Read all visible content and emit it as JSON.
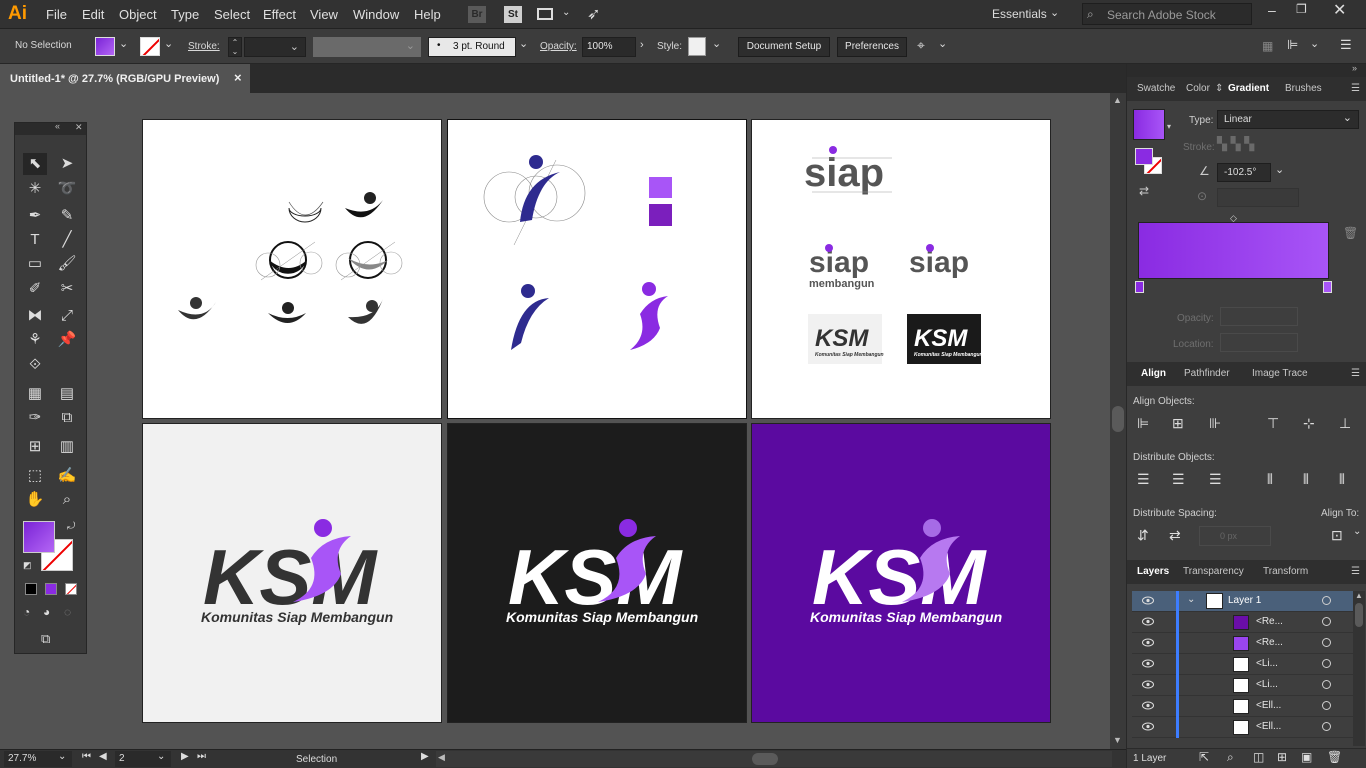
{
  "app": {
    "logo": "Ai"
  },
  "menu": [
    "File",
    "Edit",
    "Object",
    "Type",
    "Select",
    "Effect",
    "View",
    "Window",
    "Help"
  ],
  "bridge_labels": [
    "Br",
    "St"
  ],
  "workspace": "Essentials",
  "search": {
    "placeholder": "Search Adobe Stock"
  },
  "control": {
    "selection": "No Selection",
    "stroke_label": "Stroke:",
    "brush": "3 pt. Round",
    "opacity_label": "Opacity:",
    "opacity": "100%",
    "style_label": "Style:",
    "doc_setup": "Document Setup",
    "preferences": "Preferences"
  },
  "doc_tab": {
    "title": "Untitled-1* @ 27.7% (RGB/GPU Preview)",
    "close": "×"
  },
  "artboards": {
    "siap": "siap",
    "membangun": "membangun",
    "ksm_small_text": "Komunitas Siap Membangun",
    "ksm": "KSM",
    "ksm_tagline": "Komunitas Siap Membangun"
  },
  "colors": {
    "purple": "#8a2be2",
    "light_purple": "#a855f7",
    "navy": "#2e2b8f",
    "dark_purple": "#5b0aa0",
    "deep": "#6a00b0"
  },
  "status": {
    "zoom": "27.7%",
    "page": "2",
    "tool": "Selection"
  },
  "gradient_panel": {
    "tabs": [
      "Swatche",
      "Color",
      "Gradient",
      "Brushes"
    ],
    "type_label": "Type:",
    "type_value": "Linear",
    "stroke_label": "Stroke:",
    "angle": "-102.5°",
    "opacity_label": "Opacity:",
    "location_label": "Location:"
  },
  "align_panel": {
    "tabs": [
      "Align",
      "Pathfinder",
      "Image Trace"
    ],
    "align_objects": "Align Objects:",
    "distribute_objects": "Distribute Objects:",
    "distribute_spacing": "Distribute Spacing:",
    "align_to": "Align To:",
    "spacing_value": "0 px"
  },
  "layers_panel": {
    "tabs": [
      "Layers",
      "Transparency",
      "Transform"
    ],
    "layer": "Layer 1",
    "items": [
      "<Re...",
      "<Re...",
      "<Li...",
      "<Li...",
      "<Ell...",
      "<Ell..."
    ],
    "footer": "1 Layer"
  }
}
